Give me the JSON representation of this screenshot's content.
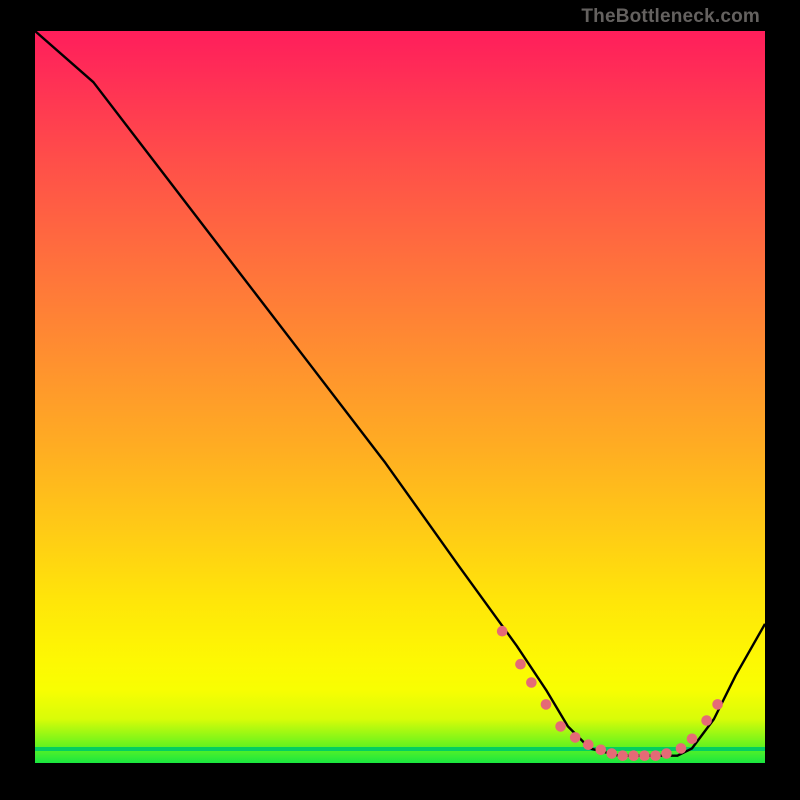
{
  "attribution": "TheBottleneck.com",
  "colors": {
    "line": "#000000",
    "dot": "#e56a76"
  },
  "chart_data": {
    "type": "line",
    "title": "",
    "xlabel": "",
    "ylabel": "",
    "xlim": [
      0,
      100
    ],
    "ylim": [
      0,
      100
    ],
    "grid": false,
    "series": [
      {
        "name": "curve",
        "x": [
          0,
          8,
          18,
          28,
          38,
          48,
          58,
          66,
          70,
          73,
          76,
          80,
          84,
          88,
          90,
          93,
          96,
          100
        ],
        "y": [
          100,
          93,
          80,
          67,
          54,
          41,
          27,
          16,
          10,
          5,
          2,
          1,
          1,
          1,
          2,
          6,
          12,
          19
        ]
      }
    ],
    "markers": {
      "name": "highlight-dots",
      "x": [
        64,
        66.5,
        68,
        70,
        72,
        74,
        75.8,
        77.5,
        79,
        80.5,
        82,
        83.5,
        85,
        86.5,
        88.5,
        90,
        92,
        93.5
      ],
      "y": [
        18,
        13.5,
        11,
        8,
        5,
        3.5,
        2.5,
        1.8,
        1.3,
        1,
        1,
        1,
        1,
        1.3,
        2,
        3.3,
        5.8,
        8
      ]
    }
  }
}
